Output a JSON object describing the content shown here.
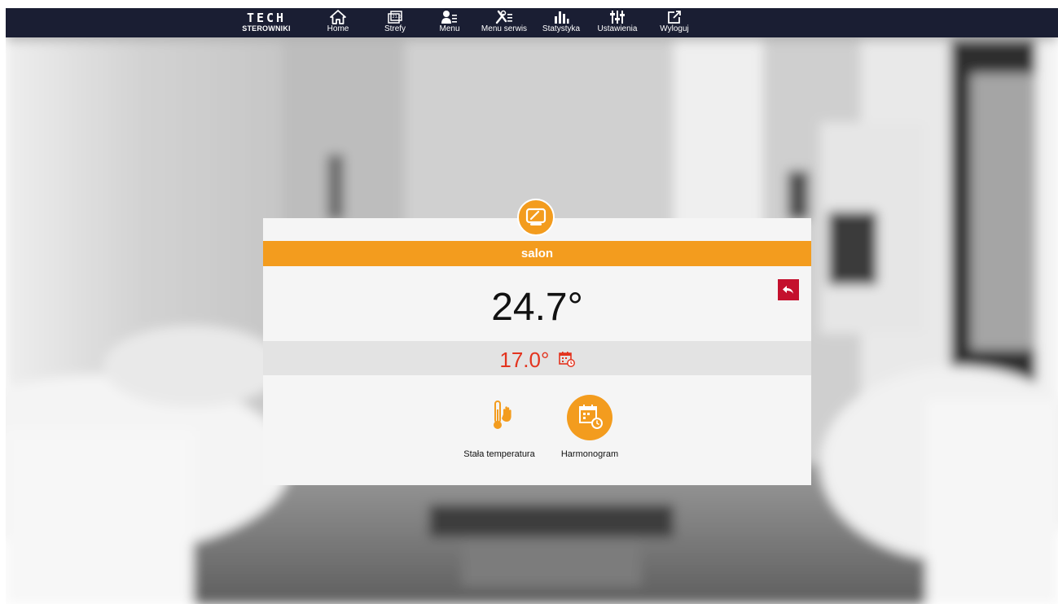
{
  "app": {
    "logo_main": "TECH",
    "logo_sub": "STEROWNIKI"
  },
  "nav": {
    "items": [
      {
        "label": "Home",
        "icon": "home-icon"
      },
      {
        "label": "Strefy",
        "icon": "zones-icon"
      },
      {
        "label": "Menu",
        "icon": "user-menu-icon"
      },
      {
        "label": "Menu serwis",
        "icon": "service-tools-icon"
      },
      {
        "label": "Statystyka",
        "icon": "statistics-bars-icon"
      },
      {
        "label": "Ustawienia",
        "icon": "sliders-icon"
      },
      {
        "label": "Wyloguj",
        "icon": "logout-icon"
      }
    ]
  },
  "zone": {
    "name": "salon",
    "icon": "room-thermostat-icon",
    "current_temperature": "24.7°",
    "set_temperature": "17.0°",
    "set_icon": "schedule-calendar-icon"
  },
  "modes": [
    {
      "label": "Stała temperatura",
      "icon": "thermometer-hand-icon",
      "active": false
    },
    {
      "label": "Harmonogram",
      "icon": "calendar-clock-icon",
      "active": true
    }
  ],
  "colors": {
    "topbar": "#1a1e33",
    "accent": "#f39c1e",
    "back_button": "#c4102d",
    "set_temperature": "#e3341f"
  }
}
